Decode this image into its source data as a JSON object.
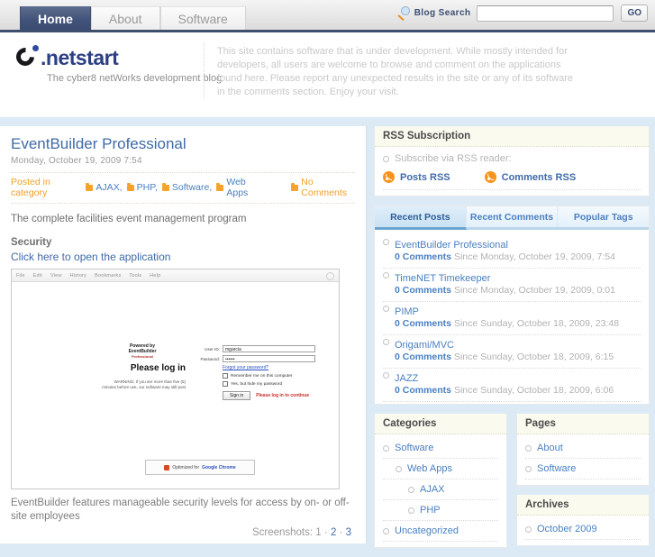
{
  "nav": {
    "tabs": [
      {
        "label": "Home",
        "active": true
      },
      {
        "label": "About",
        "active": false
      },
      {
        "label": "Software",
        "active": false
      }
    ]
  },
  "search": {
    "label": "Blog Search",
    "value": "",
    "placeholder": "",
    "button": "GO",
    "icon": "magnifier-icon"
  },
  "branding": {
    "logo_text": ".netstart",
    "tagline": "The cyber8 netWorks development blog",
    "blurb": "This site contains software that is under development. While mostly intended for developers, all users are welcome to browse and comment on the applications found here. Please report any unexpected results in the site or any of its software in the comments section. Enjoy your visit."
  },
  "post": {
    "title": "EventBuilder Professional",
    "date": "Monday, October 19, 2009 7:54",
    "posted_in_label": "Posted in category",
    "categories": [
      "AJAX,",
      "PHP,",
      "Software,",
      "Web Apps"
    ],
    "comments_label": "No Comments",
    "lead": "The complete facilities event management program",
    "subhead": "Security",
    "app_link": "Click here to open the application",
    "caption": "EventBuilder features manageable security levels for access by on- or off-site employees",
    "screenshots_label": "Screenshots:",
    "screenshot_links": [
      "1",
      "2",
      "3"
    ],
    "screenshot_separator": "·"
  },
  "embedded_shot": {
    "menu": [
      "File",
      "Edit",
      "View",
      "History",
      "Bookmarks",
      "Tools",
      "Help"
    ],
    "brand_top": "Powered by",
    "brand_name": "EventBuilder",
    "brand_sub": "Professional",
    "heading": "Please log in",
    "warning": "WARNING: If you are more than five (5) minutes before use, our software may still post",
    "fields": [
      {
        "label": "User ID:",
        "value": "mgarcia"
      },
      {
        "label": "Password:",
        "value": "••••••"
      }
    ],
    "forgot_link": "Forgot your password?",
    "checkboxes": [
      "Remember me on this computer",
      "Yes, but hide my password"
    ],
    "submit_label": "Sign in",
    "error_text": "Please log in to continue",
    "powered_prefix": "Optimized for",
    "powered_link": "Google Chrome"
  },
  "sidebar": {
    "rss": {
      "title": "RSS Subscription",
      "note": "Subscribe via RSS reader:",
      "posts_link": "Posts RSS",
      "comments_link": "Comments RSS"
    },
    "tabs": [
      {
        "label": "Recent Posts",
        "active": true
      },
      {
        "label": "Recent Comments",
        "active": false
      },
      {
        "label": "Popular Tags",
        "active": false
      }
    ],
    "recent_posts": [
      {
        "title": "EventBuilder Professional",
        "count": "0 Comments",
        "since": "Since Monday, October 19, 2009, 7:54"
      },
      {
        "title": "TimeNET Timekeeper",
        "count": "0 Comments",
        "since": "Since Monday, October 19, 2009, 0:01"
      },
      {
        "title": "PIMP",
        "count": "0 Comments",
        "since": "Since Sunday, October 18, 2009, 23:48"
      },
      {
        "title": "Origami/MVC",
        "count": "0 Comments",
        "since": "Since Sunday, October 18, 2009, 6:15"
      },
      {
        "title": "JAZZ",
        "count": "0 Comments",
        "since": "Since Sunday, October 18, 2009, 6:06"
      }
    ],
    "categories": {
      "title": "Categories",
      "items": [
        {
          "label": "Software",
          "level": 0
        },
        {
          "label": "Web Apps",
          "level": 1
        },
        {
          "label": "AJAX",
          "level": 2
        },
        {
          "label": "PHP",
          "level": 2
        },
        {
          "label": "Uncategorized",
          "level": 0
        }
      ]
    },
    "pages": {
      "title": "Pages",
      "items": [
        "About",
        "Software"
      ]
    },
    "archives": {
      "title": "Archives",
      "items": [
        "October 2009"
      ]
    }
  },
  "colors": {
    "nav_active": "#3b4c72",
    "link": "#4a7fc1",
    "accent_orange": "#f7941d",
    "panel_blue": "#dceaf5"
  }
}
